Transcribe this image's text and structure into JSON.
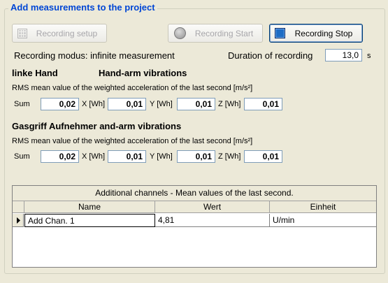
{
  "group_title": "Add measurements to the project",
  "buttons": {
    "setup": "Recording setup",
    "start": "Recording Start",
    "stop": "Recording Stop"
  },
  "recording": {
    "modus_label": "Recording modus: infinite measurement",
    "duration_label": "Duration of recording",
    "duration_value": "13,0",
    "duration_unit": "s"
  },
  "section1": {
    "title_left": "linke Hand",
    "title_right": "Hand-arm vibrations",
    "description": "RMS mean value of the weighted acceleration of the last second [m/s²]",
    "sum_label": "Sum",
    "sum": "0,02",
    "x_label": "X [Wh]",
    "x": "0,01",
    "y_label": "Y [Wh]",
    "y": "0,01",
    "z_label": "Z [Wh]",
    "z": "0,01"
  },
  "section2": {
    "title": "Gasgriff Aufnehmer and-arm vibrations",
    "description": "RMS mean value of the weighted acceleration of the last second [m/s²]",
    "sum_label": "Sum",
    "sum": "0,02",
    "x_label": "X [Wh]",
    "x": "0,01",
    "y_label": "Y [Wh]",
    "y": "0,01",
    "z_label": "Z [Wh]",
    "z": "0,01"
  },
  "table": {
    "caption": "Additional channels - Mean values of the last second.",
    "columns": [
      "Name",
      "Wert",
      "Einheit"
    ],
    "rows": [
      {
        "name": "Add Chan. 1",
        "wert": "4,81",
        "einheit": "U/min"
      }
    ]
  }
}
